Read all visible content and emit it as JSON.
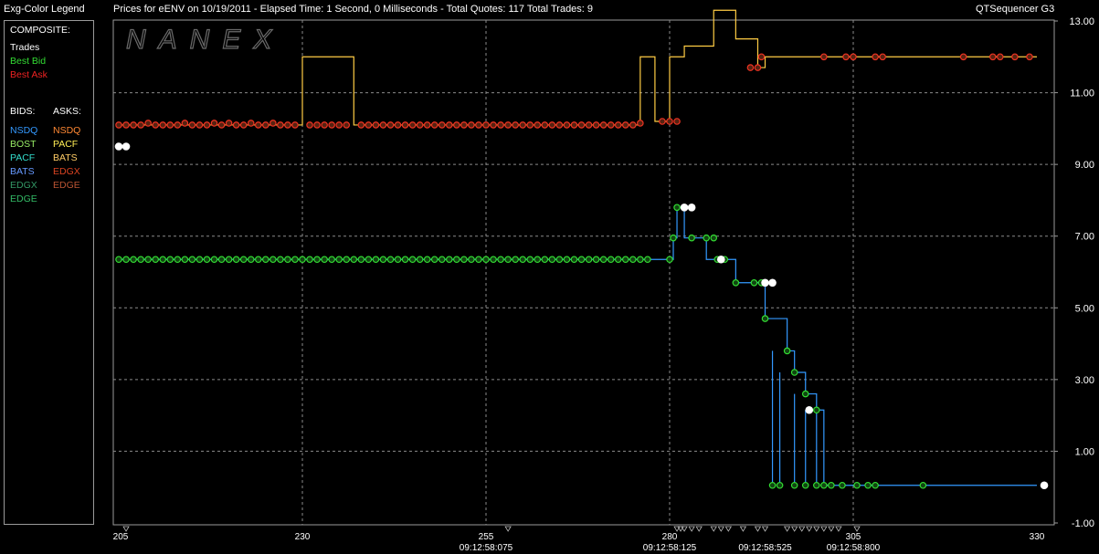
{
  "header": {
    "legend_title": "Exg-Color Legend",
    "prices_for": "Prices for  eENV  on  10/19/2011  -  Elapsed Time: 1 Second, 0 Milliseconds  -  Total Quotes: 117  Total Trades: 9",
    "app_name": "QTSequencer G3"
  },
  "watermark": "NANEX",
  "legend": {
    "composite_title": "COMPOSITE:",
    "composite": [
      {
        "label": "Trades",
        "color": "#ffffff"
      },
      {
        "label": "Best Bid",
        "color": "#33dd33"
      },
      {
        "label": "Best Ask",
        "color": "#ee2222"
      }
    ],
    "bids_title": "BIDS:",
    "asks_title": "ASKS:",
    "bids": [
      {
        "label": "NSDQ",
        "color": "#3399ff"
      },
      {
        "label": "BOST",
        "color": "#99ee66"
      },
      {
        "label": "PACF",
        "color": "#33ddcc"
      },
      {
        "label": "BATS",
        "color": "#6699ff"
      },
      {
        "label": "EDGX",
        "color": "#339966"
      },
      {
        "label": "EDGE",
        "color": "#33bb66"
      }
    ],
    "asks": [
      {
        "label": "NSDQ",
        "color": "#ff8833"
      },
      {
        "label": "PACF",
        "color": "#ffee55"
      },
      {
        "label": "BATS",
        "color": "#ffcc66"
      },
      {
        "label": "EDGX",
        "color": "#dd4422"
      },
      {
        "label": "EDGE",
        "color": "#bb5533"
      }
    ]
  },
  "chart_data": {
    "type": "line",
    "x_range": [
      205,
      330
    ],
    "y_range": [
      -1.0,
      13.0
    ],
    "y_ticks": [
      "13.00",
      "11.00",
      "9.00",
      "7.00",
      "5.00",
      "3.00",
      "1.00",
      "-1.00"
    ],
    "x_ticks": [
      "205",
      "230",
      "255",
      "280",
      "305",
      "330"
    ],
    "time_labels": [
      {
        "x": 255,
        "label": "09:12:58:075"
      },
      {
        "x": 280,
        "label": "09:12:58:125"
      },
      {
        "x": 293,
        "label": "09:12:58:525"
      },
      {
        "x": 305,
        "label": "09:12:58:800"
      }
    ],
    "grid": true,
    "colors": {
      "bid_line": "#3399ff",
      "ask_line": "#ffcc44",
      "bid_marker": "#33dd33",
      "ask_marker": "#ee3322",
      "trade_marker": "#ffffff"
    },
    "best_bid_steps": [
      [
        205,
        6.35
      ],
      [
        280,
        6.35
      ],
      [
        280.5,
        6.95
      ],
      [
        281,
        7.8
      ],
      [
        282,
        6.95
      ],
      [
        285,
        6.35
      ],
      [
        289,
        5.7
      ],
      [
        293,
        4.7
      ],
      [
        296,
        3.8
      ],
      [
        297,
        3.2
      ],
      [
        298.5,
        2.6
      ],
      [
        300,
        2.15
      ],
      [
        301,
        0.05
      ],
      [
        330,
        0.05
      ]
    ],
    "bid_markers_x": [
      205,
      206,
      207,
      208,
      209,
      210,
      211,
      212,
      213,
      214,
      215,
      216,
      217,
      218,
      219,
      220,
      221,
      222,
      223,
      224,
      225,
      226,
      227,
      228,
      229,
      230,
      231,
      232,
      233,
      234,
      235,
      236,
      237,
      238,
      239,
      240,
      241,
      242,
      243,
      244,
      245,
      246,
      247,
      248,
      249,
      250,
      251,
      252,
      253,
      254,
      255,
      256,
      257,
      258,
      259,
      260,
      261,
      262,
      263,
      264,
      265,
      266,
      267,
      268,
      269,
      270,
      271,
      272,
      273,
      274,
      275,
      276,
      277
    ],
    "bid_markers_right": [
      [
        280,
        6.35
      ],
      [
        280.5,
        6.95
      ],
      [
        281,
        7.8
      ],
      [
        282,
        7.8
      ],
      [
        283,
        6.95
      ],
      [
        285,
        6.95
      ],
      [
        286,
        6.95
      ],
      [
        286.5,
        6.35
      ],
      [
        287.5,
        6.35
      ],
      [
        289,
        5.7
      ],
      [
        291.5,
        5.7
      ],
      [
        292.5,
        5.7
      ],
      [
        293,
        4.7
      ],
      [
        296,
        3.8
      ],
      [
        297,
        3.2
      ],
      [
        298.5,
        2.6
      ],
      [
        300,
        2.15
      ],
      [
        294,
        0.05
      ],
      [
        295,
        0.05
      ],
      [
        297,
        0.05
      ],
      [
        298.5,
        0.05
      ],
      [
        300,
        0.05
      ],
      [
        301,
        0.05
      ],
      [
        302,
        0.05
      ],
      [
        303.5,
        0.05
      ],
      [
        305.5,
        0.05
      ],
      [
        307,
        0.05
      ],
      [
        308,
        0.05
      ],
      [
        314.5,
        0.05
      ]
    ],
    "best_ask_steps": [
      [
        205,
        10.1
      ],
      [
        230,
        10.1
      ],
      [
        230,
        12.0
      ],
      [
        237,
        12.0
      ],
      [
        237,
        10.1
      ],
      [
        276,
        10.1
      ],
      [
        276,
        12.0
      ],
      [
        278,
        12.0
      ],
      [
        278,
        10.2
      ],
      [
        280,
        10.2
      ],
      [
        280,
        12.0
      ],
      [
        282,
        12.0
      ],
      [
        282,
        12.3
      ],
      [
        286,
        12.3
      ],
      [
        286,
        13.3
      ],
      [
        289,
        13.3
      ],
      [
        289,
        12.5
      ],
      [
        292,
        12.5
      ],
      [
        292,
        11.7
      ],
      [
        293,
        11.7
      ],
      [
        293,
        12.0
      ],
      [
        330,
        12.0
      ]
    ],
    "ask_markers": [
      [
        205,
        10.1
      ],
      [
        206,
        10.1
      ],
      [
        207,
        10.1
      ],
      [
        208,
        10.1
      ],
      [
        209,
        10.15
      ],
      [
        210,
        10.1
      ],
      [
        211,
        10.1
      ],
      [
        212,
        10.1
      ],
      [
        213,
        10.1
      ],
      [
        214,
        10.15
      ],
      [
        215,
        10.1
      ],
      [
        216,
        10.1
      ],
      [
        217,
        10.1
      ],
      [
        218,
        10.15
      ],
      [
        219,
        10.1
      ],
      [
        220,
        10.15
      ],
      [
        221,
        10.1
      ],
      [
        222,
        10.1
      ],
      [
        223,
        10.15
      ],
      [
        224,
        10.1
      ],
      [
        225,
        10.1
      ],
      [
        226,
        10.15
      ],
      [
        227,
        10.1
      ],
      [
        228,
        10.1
      ],
      [
        229,
        10.1
      ],
      [
        231,
        10.1
      ],
      [
        232,
        10.1
      ],
      [
        233,
        10.1
      ],
      [
        234,
        10.1
      ],
      [
        235,
        10.1
      ],
      [
        236,
        10.1
      ],
      [
        238,
        10.1
      ],
      [
        239,
        10.1
      ],
      [
        240,
        10.1
      ],
      [
        241,
        10.1
      ],
      [
        242,
        10.1
      ],
      [
        243,
        10.1
      ],
      [
        244,
        10.1
      ],
      [
        245,
        10.1
      ],
      [
        246,
        10.1
      ],
      [
        247,
        10.1
      ],
      [
        248,
        10.1
      ],
      [
        249,
        10.1
      ],
      [
        250,
        10.1
      ],
      [
        251,
        10.1
      ],
      [
        252,
        10.1
      ],
      [
        253,
        10.1
      ],
      [
        254,
        10.1
      ],
      [
        255,
        10.1
      ],
      [
        256,
        10.1
      ],
      [
        257,
        10.1
      ],
      [
        258,
        10.1
      ],
      [
        259,
        10.1
      ],
      [
        260,
        10.1
      ],
      [
        261,
        10.1
      ],
      [
        262,
        10.1
      ],
      [
        263,
        10.1
      ],
      [
        264,
        10.1
      ],
      [
        265,
        10.1
      ],
      [
        266,
        10.1
      ],
      [
        267,
        10.1
      ],
      [
        268,
        10.1
      ],
      [
        269,
        10.1
      ],
      [
        270,
        10.1
      ],
      [
        271,
        10.1
      ],
      [
        272,
        10.1
      ],
      [
        273,
        10.1
      ],
      [
        274,
        10.1
      ],
      [
        275,
        10.1
      ],
      [
        276,
        10.15
      ],
      [
        279,
        10.2
      ],
      [
        280,
        10.2
      ],
      [
        281,
        10.2
      ],
      [
        291,
        11.7
      ],
      [
        292,
        11.7
      ],
      [
        292.5,
        12.0
      ],
      [
        301,
        12.0
      ],
      [
        304,
        12.0
      ],
      [
        305,
        12.0
      ],
      [
        308,
        12.0
      ],
      [
        309,
        12.0
      ],
      [
        320,
        12.0
      ],
      [
        324,
        12.0
      ],
      [
        325,
        12.0
      ],
      [
        327,
        12.0
      ],
      [
        329,
        12.0
      ]
    ],
    "trades": [
      [
        205,
        9.5
      ],
      [
        206,
        9.5
      ],
      [
        282,
        7.8
      ],
      [
        283,
        7.8
      ],
      [
        287,
        6.35
      ],
      [
        293,
        5.7
      ],
      [
        294,
        5.7
      ],
      [
        299,
        2.15
      ],
      [
        331,
        0.05
      ]
    ],
    "tick_marks_x": [
      206,
      258,
      281,
      281.5,
      282,
      283,
      284,
      286,
      287,
      288,
      290,
      292,
      293,
      296,
      297,
      298,
      299,
      300,
      301,
      302,
      303,
      305.5
    ]
  }
}
